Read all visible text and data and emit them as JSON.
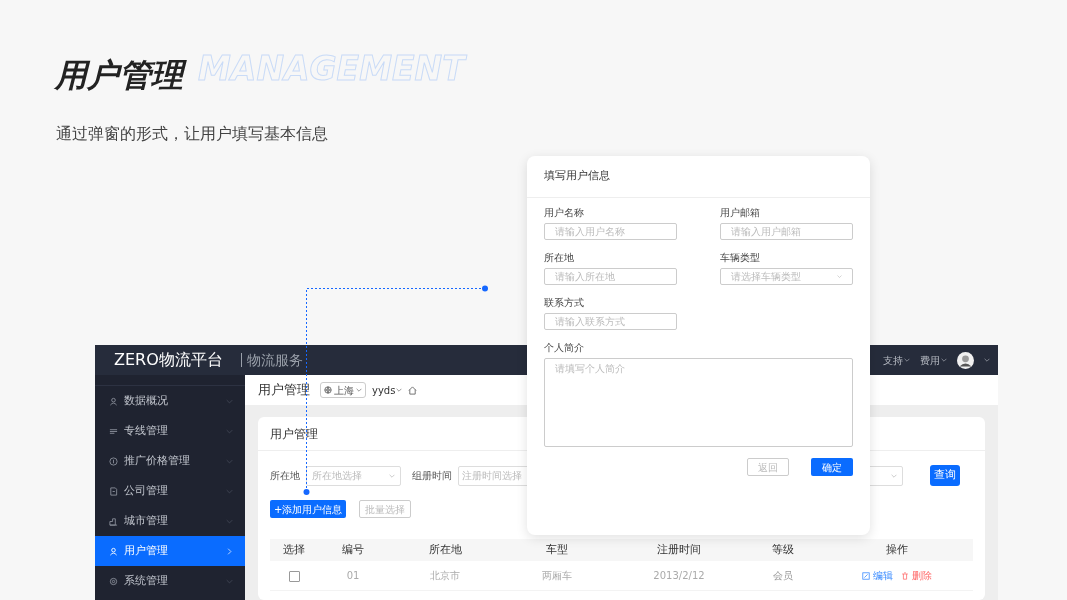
{
  "slide": {
    "watermark": "MANAGEMENT",
    "title": "用户管理",
    "subtitle": "通过弹窗的形式，让用户填写基本信息"
  },
  "app": {
    "logo": "ZERO物流平台",
    "product": "物流服务",
    "top_menu": [
      {
        "label": "支持"
      },
      {
        "label": "费用"
      }
    ],
    "sidebar": {
      "items": [
        {
          "label": "数据概况",
          "selected": false
        },
        {
          "label": "专线管理",
          "selected": false
        },
        {
          "label": "推广价格管理",
          "selected": false
        },
        {
          "label": "公司管理",
          "selected": false
        },
        {
          "label": "城市管理",
          "selected": false
        },
        {
          "label": "用户管理",
          "selected": true
        },
        {
          "label": "系统管理",
          "selected": false
        }
      ]
    },
    "breadcrumb": {
      "title": "用户管理",
      "city": "上海",
      "user": "yyds"
    },
    "card": {
      "title": "用户管理",
      "filters": [
        {
          "kind": "select",
          "label": "所在地",
          "placeholder": "所在地选择"
        },
        {
          "kind": "input",
          "label": "组册时间",
          "placeholder": "注册时间选择"
        },
        {
          "kind": "select"
        }
      ],
      "search_button": "查询",
      "add_button": "+添加用户信息",
      "batch_button": {
        "label": "批量选择",
        "disabled": true
      },
      "table": {
        "columns": [
          "选择",
          "编号",
          "所在地",
          "车型",
          "注册时间",
          "等级",
          "操作"
        ],
        "rows": [
          {
            "checked": false,
            "cells": [
              "",
              "01",
              "北京市",
              "两厢车",
              "2013/2/12",
              "会员"
            ],
            "member": true,
            "actions": [
              "编辑",
              "删除"
            ]
          }
        ]
      }
    }
  },
  "modal": {
    "title": "填写用户信息",
    "fields": [
      {
        "kind": "input",
        "label": "用户名称",
        "placeholder": "请输入用户名称"
      },
      {
        "kind": "input",
        "label": "用户邮箱",
        "placeholder": "请输入用户邮箱"
      },
      {
        "kind": "input",
        "label": "所在地",
        "placeholder": "请输入所在地"
      },
      {
        "kind": "select",
        "label": "车辆类型",
        "placeholder": "请选择车辆类型"
      },
      {
        "kind": "input",
        "label": "联系方式",
        "placeholder": "请输入联系方式"
      },
      {
        "kind": "textarea",
        "label": "个人简介",
        "placeholder": "请填写个人简介"
      }
    ],
    "buttons": [
      {
        "kind": "secondary",
        "label": "返回"
      },
      {
        "kind": "primary",
        "label": "确定"
      }
    ]
  }
}
